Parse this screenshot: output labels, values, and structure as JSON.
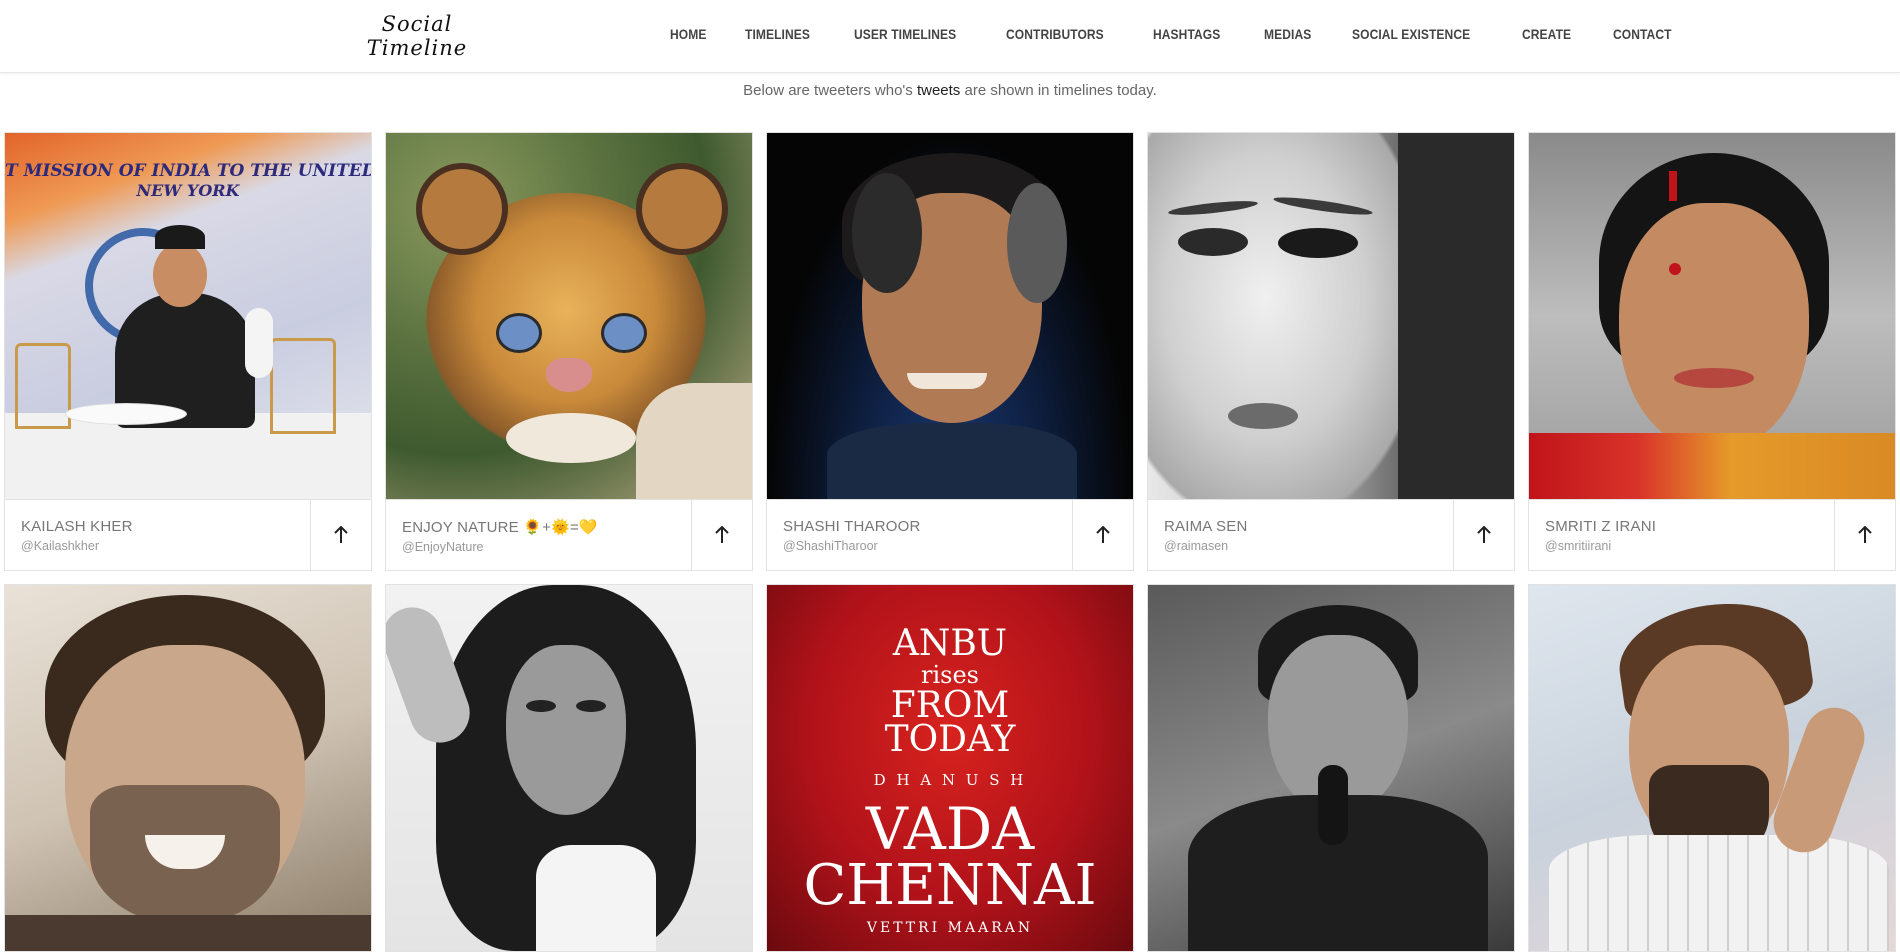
{
  "header": {
    "logo_line1": "Social",
    "logo_line2": "Timeline",
    "nav": [
      "HOME",
      "TIMELINES",
      "USER TIMELINES",
      "CONTRIBUTORS",
      "HASHTAGS",
      "MEDIAS",
      "SOCIAL EXISTENCE",
      "CREATE",
      "CONTACT"
    ]
  },
  "intro": {
    "before": "Below are tweeters who's ",
    "bold": "tweets",
    "after": " are shown in timelines today."
  },
  "cards": [
    {
      "name": "KAILASH KHER",
      "handle": "@Kailashkher",
      "banner": "T MISSION OF INDIA TO THE UNITED N",
      "banner2": "NEW YORK"
    },
    {
      "name": "ENJOY NATURE 🌻+🌞=💛",
      "handle": "@EnjoyNature"
    },
    {
      "name": "SHASHI THAROOR",
      "handle": "@ShashiTharoor"
    },
    {
      "name": "RAIMA SEN",
      "handle": "@raimasen"
    },
    {
      "name": "SMRITI Z IRANI",
      "handle": "@smritiirani"
    }
  ],
  "row2": [
    {
      "alt": "user-photo-6"
    },
    {
      "alt": "user-photo-7"
    },
    {
      "poster": [
        "ANBU",
        "rises",
        "FROM",
        "TODAY",
        "D H A N U S H",
        "VADA",
        "CHENNAI",
        "VETTRI MAARAN"
      ]
    },
    {
      "alt": "user-photo-9"
    },
    {
      "alt": "user-photo-10"
    }
  ],
  "colors": {
    "nav_text": "#444444",
    "card_border": "#e2e2e2",
    "poster_red": "#b0121a"
  }
}
